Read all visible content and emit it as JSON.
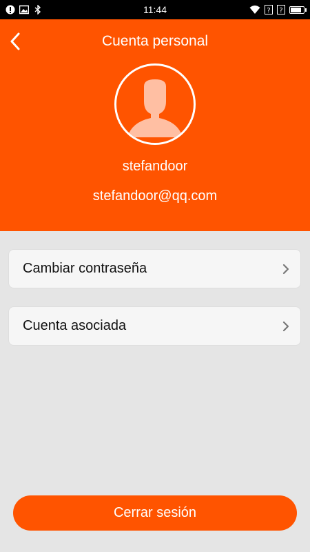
{
  "status_bar": {
    "time": "11:44",
    "left_icons": [
      "notification-icon",
      "image-icon",
      "bluetooth-icon"
    ],
    "right_icons": [
      "wifi-icon",
      "signal-sim1-icon",
      "signal-sim2-icon",
      "battery-icon"
    ]
  },
  "header": {
    "title": "Cuenta personal",
    "back_icon": "chevron-left-icon",
    "avatar_icon": "user-silhouette-icon",
    "username": "stefandoor",
    "email": "stefandoor@qq.com"
  },
  "menu": {
    "items": [
      {
        "label": "Cambiar contraseña",
        "icon": "chevron-right-icon"
      },
      {
        "label": "Cuenta asociada",
        "icon": "chevron-right-icon"
      }
    ]
  },
  "actions": {
    "logout_label": "Cerrar sesión"
  },
  "colors": {
    "accent": "#ff5400",
    "background": "#e5e5e5",
    "card": "#f6f6f6"
  }
}
